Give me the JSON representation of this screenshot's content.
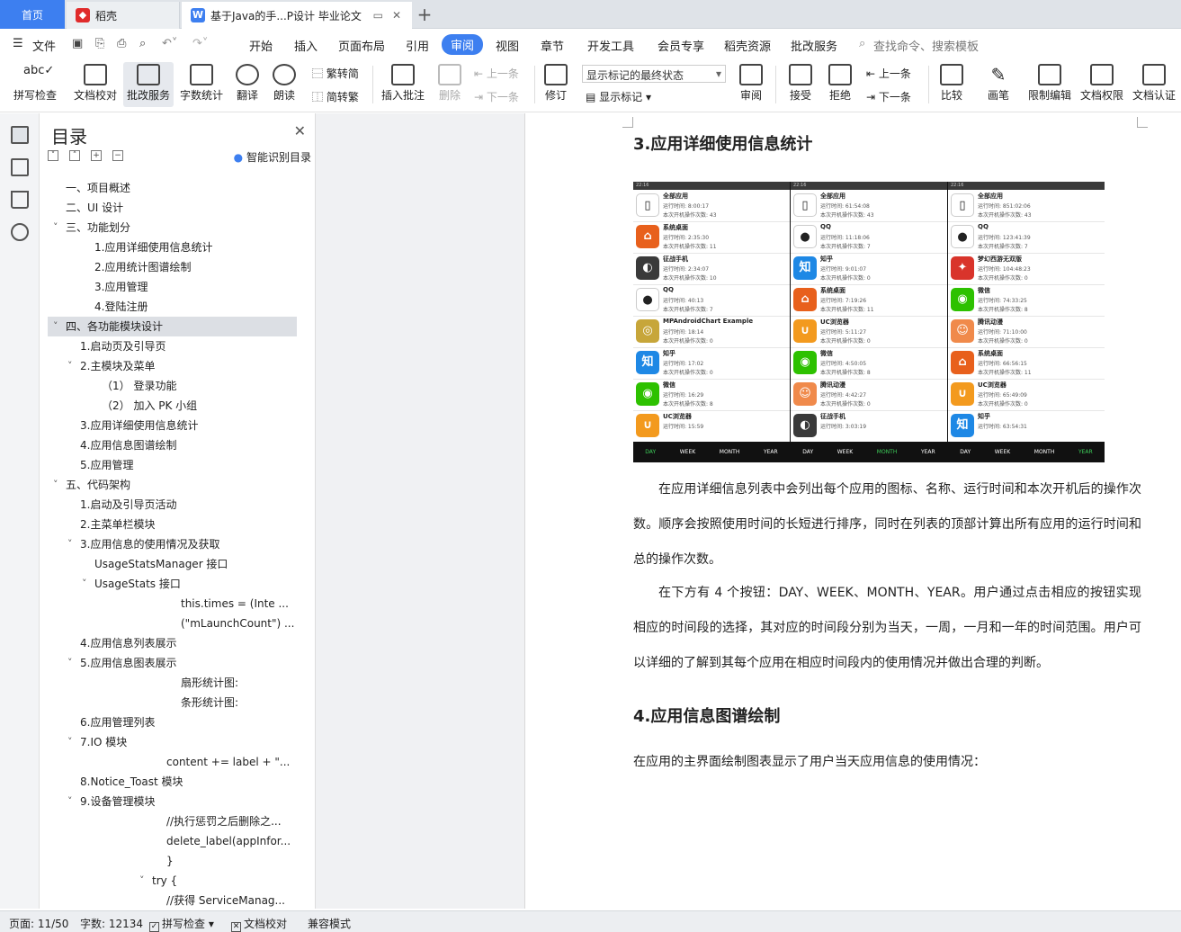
{
  "tabs": {
    "home": "首页",
    "app": "稻壳",
    "document": "基于Java的手...P设计 毕业论文"
  },
  "menubar": {
    "file": "文件",
    "items": [
      "开始",
      "插入",
      "页面布局",
      "引用",
      "审阅",
      "视图",
      "章节",
      "开发工具",
      "会员专享",
      "稻壳资源",
      "批改服务"
    ],
    "search": "查找命令、搜索模板"
  },
  "ribbon": {
    "spell_check": "拼写检查",
    "doc_proof": "文档校对",
    "correction_service": "批改服务",
    "word_count": "字数统计",
    "translate": "翻译",
    "read_aloud": "朗读",
    "trad_to_simp": "繁转简",
    "simp_to_trad": "简转繁",
    "insert_comment": "插入批注",
    "delete": "删除",
    "prev_comment": "上一条",
    "next_comment": "下一条",
    "revise": "修订",
    "markup_state": "显示标记的最终状态",
    "show_markup": "显示标记",
    "review": "审阅",
    "accept": "接受",
    "reject": "拒绝",
    "prev": "上一条",
    "next": "下一条",
    "compare": "比较",
    "pen": "画笔",
    "restrict_edit": "限制编辑",
    "doc_permission": "文档权限",
    "doc_auth": "文档认证"
  },
  "nav": {
    "title": "目录",
    "smart_toc": "智能识别目录",
    "items": [
      {
        "text": "一、项目概述"
      },
      {
        "text": "二、UI 设计"
      },
      {
        "text": "三、功能划分"
      },
      {
        "text": "1.应用详细使用信息统计"
      },
      {
        "text": "2.应用统计图谱绘制"
      },
      {
        "text": "3.应用管理"
      },
      {
        "text": "4.登陆注册"
      },
      {
        "text": "四、各功能模块设计"
      },
      {
        "text": "1.启动页及引导页"
      },
      {
        "text": "2.主模块及菜单"
      },
      {
        "text": "（1）  登录功能"
      },
      {
        "text": "（2）  加入 PK 小组"
      },
      {
        "text": "3.应用详细使用信息统计"
      },
      {
        "text": "4.应用信息图谱绘制"
      },
      {
        "text": "5.应用管理"
      },
      {
        "text": "五、代码架构"
      },
      {
        "text": "1.启动及引导页活动"
      },
      {
        "text": "2.主菜单栏模块"
      },
      {
        "text": "3.应用信息的使用情况及获取"
      },
      {
        "text": "UsageStatsManager 接口"
      },
      {
        "text": "UsageStats 接口"
      },
      {
        "text": "this.times  =  (Inte ..."
      },
      {
        "text": "(\"mLaunchCount\") ..."
      },
      {
        "text": "4.应用信息列表展示"
      },
      {
        "text": "5.应用信息图表展示"
      },
      {
        "text": "扇形统计图:"
      },
      {
        "text": "条形统计图:"
      },
      {
        "text": "6.应用管理列表"
      },
      {
        "text": "7.IO 模块"
      },
      {
        "text": "content += label + \"..."
      },
      {
        "text": "8.Notice_Toast 模块"
      },
      {
        "text": "9.设备管理模块"
      },
      {
        "text": "//执行惩罚之后删除之..."
      },
      {
        "text": "delete_label(appInfor..."
      },
      {
        "text": "}"
      },
      {
        "text": "try {"
      },
      {
        "text": "//获得 ServiceManag..."
      }
    ]
  },
  "document": {
    "heading3": "3.应用详细使用信息统计",
    "para1": "在应用详细信息列表中会列出每个应用的图标、名称、运行时间和本次开机后的操作次数。顺序会按照使用时间的长短进行排序，同时在列表的顶部计算出所有应用的运行时间和总的操作次数。",
    "para2": "在下方有 4 个按钮：DAY、WEEK、MONTH、YEAR。用户通过点击相应的按钮实现相应的时间段的选择，其对应的时间段分别为当天，一周，一月和一年的时间范围。用户可以详细的了解到其每个应用在相应时间段内的使用情况并做出合理的判断。",
    "heading4": "4.应用信息图谱绘制",
    "para3": "在应用的主界面绘制图表显示了用户当天应用信息的使用情况："
  },
  "phones": [
    {
      "status": "22:16",
      "rows": [
        {
          "name": "全部应用",
          "t1": "运行时间: 8:00:17",
          "t2": "本次开机操作次数: 43",
          "color": "#ffffff",
          "glyph": "▯"
        },
        {
          "name": "系统桌面",
          "t1": "运行时间: 2:35:30",
          "t2": "本次开机操作次数: 11",
          "color": "#e8601c",
          "glyph": "⌂"
        },
        {
          "name": "征战手机",
          "t1": "运行时间: 2:34:07",
          "t2": "本次开机操作次数: 10",
          "color": "#3a3a3a",
          "glyph": "◐"
        },
        {
          "name": "QQ",
          "t1": "运行时间: 40:13",
          "t2": "本次开机操作次数: 7",
          "color": "#ffffff",
          "glyph": "●"
        },
        {
          "name": "MPAndroidChart Example",
          "t1": "运行时间: 18:14",
          "t2": "本次开机操作次数: 0",
          "color": "#c7a63a",
          "glyph": "◎"
        },
        {
          "name": "知乎",
          "t1": "运行时间: 17:02",
          "t2": "本次开机操作次数: 0",
          "color": "#1e88e5",
          "glyph": "知"
        },
        {
          "name": "微信",
          "t1": "运行时间: 16:29",
          "t2": "本次开机操作次数: 8",
          "color": "#2dc100",
          "glyph": "◉"
        },
        {
          "name": "UC浏览器",
          "t1": "运行时间: 15:59",
          "t2": "",
          "color": "#f39a1e",
          "glyph": "∪"
        }
      ],
      "buttons": [
        "DAY",
        "WEEK",
        "MONTH",
        "YEAR"
      ],
      "active": 0
    },
    {
      "status": "22:16",
      "rows": [
        {
          "name": "全部应用",
          "t1": "运行时间: 61:54:08",
          "t2": "本次开机操作次数: 43",
          "color": "#ffffff",
          "glyph": "▯"
        },
        {
          "name": "QQ",
          "t1": "运行时间: 11:18:06",
          "t2": "本次开机操作次数: 7",
          "color": "#ffffff",
          "glyph": "●"
        },
        {
          "name": "知乎",
          "t1": "运行时间: 9:01:07",
          "t2": "本次开机操作次数: 0",
          "color": "#1e88e5",
          "glyph": "知"
        },
        {
          "name": "系统桌面",
          "t1": "运行时间: 7:19:26",
          "t2": "本次开机操作次数: 11",
          "color": "#e8601c",
          "glyph": "⌂"
        },
        {
          "name": "UC浏览器",
          "t1": "运行时间: 5:11:27",
          "t2": "本次开机操作次数: 0",
          "color": "#f39a1e",
          "glyph": "∪"
        },
        {
          "name": "微信",
          "t1": "运行时间: 4:50:05",
          "t2": "本次开机操作次数: 8",
          "color": "#2dc100",
          "glyph": "◉"
        },
        {
          "name": "腾讯动漫",
          "t1": "运行时间: 4:42:27",
          "t2": "本次开机操作次数: 0",
          "color": "#f08a4b",
          "glyph": "☺"
        },
        {
          "name": "征战手机",
          "t1": "运行时间: 3:03:19",
          "t2": "",
          "color": "#3a3a3a",
          "glyph": "◐"
        }
      ],
      "buttons": [
        "DAY",
        "WEEK",
        "MONTH",
        "YEAR"
      ],
      "active": 2
    },
    {
      "status": "22:16",
      "rows": [
        {
          "name": "全部应用",
          "t1": "运行时间: 851:02:06",
          "t2": "本次开机操作次数: 43",
          "color": "#ffffff",
          "glyph": "▯"
        },
        {
          "name": "QQ",
          "t1": "运行时间: 123:41:39",
          "t2": "本次开机操作次数: 7",
          "color": "#ffffff",
          "glyph": "●"
        },
        {
          "name": "梦幻西游无双版",
          "t1": "运行时间: 104:48:23",
          "t2": "本次开机操作次数: 0",
          "color": "#d9342b",
          "glyph": "✦"
        },
        {
          "name": "微信",
          "t1": "运行时间: 74:33:25",
          "t2": "本次开机操作次数: 8",
          "color": "#2dc100",
          "glyph": "◉"
        },
        {
          "name": "腾讯动漫",
          "t1": "运行时间: 71:10:00",
          "t2": "本次开机操作次数: 0",
          "color": "#f08a4b",
          "glyph": "☺"
        },
        {
          "name": "系统桌面",
          "t1": "运行时间: 66:56:15",
          "t2": "本次开机操作次数: 11",
          "color": "#e8601c",
          "glyph": "⌂"
        },
        {
          "name": "UC浏览器",
          "t1": "运行时间: 65:49:09",
          "t2": "本次开机操作次数: 0",
          "color": "#f39a1e",
          "glyph": "∪"
        },
        {
          "name": "知乎",
          "t1": "运行时间: 63:54:31",
          "t2": "",
          "color": "#1e88e5",
          "glyph": "知"
        }
      ],
      "buttons": [
        "DAY",
        "WEEK",
        "MONTH",
        "YEAR"
      ],
      "active": 3
    }
  ],
  "statusbar": {
    "page": "页面: 11/50",
    "words": "字数: 12134",
    "spell": "拼写检查",
    "proof": "文档校对",
    "compat": "兼容模式"
  },
  "colors": {
    "accent": "#3d7ff0",
    "active_green": "#3ecf5a"
  }
}
